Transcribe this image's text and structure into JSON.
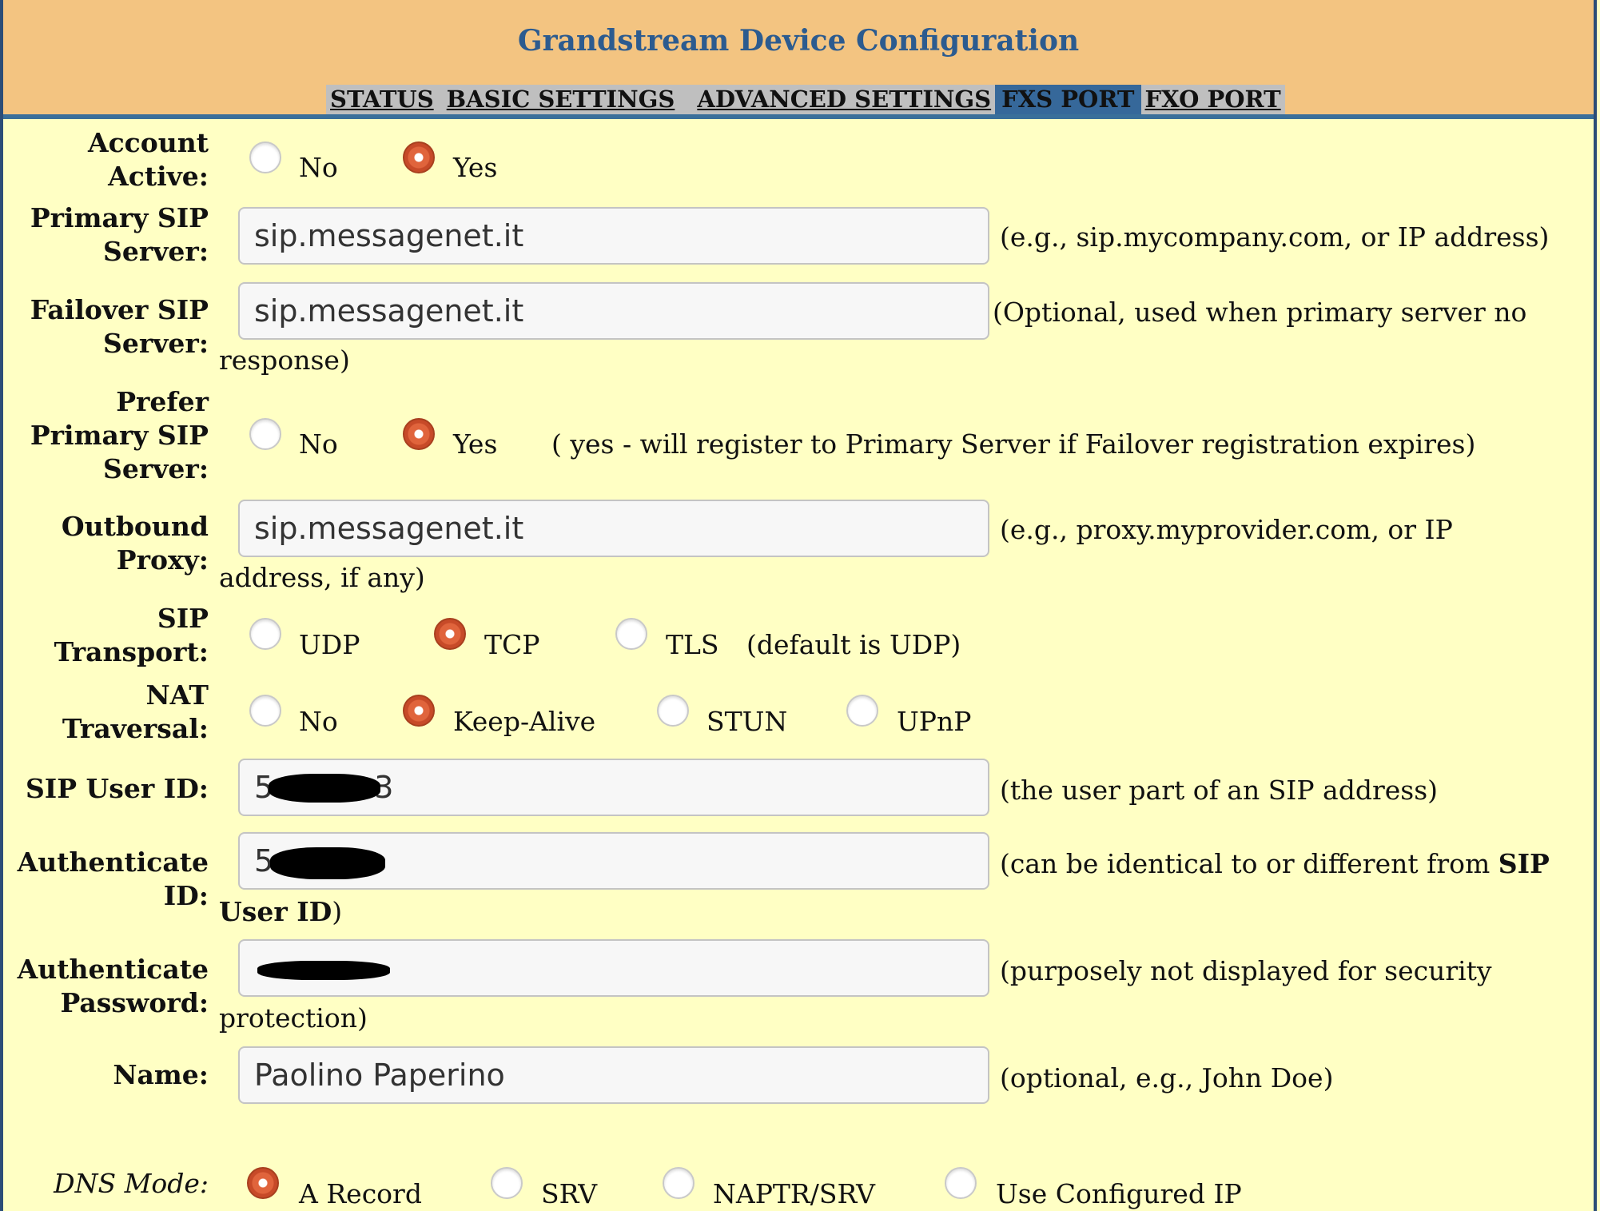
{
  "header": {
    "title": "Grandstream Device Configuration",
    "tabs": [
      "STATUS",
      "BASIC SETTINGS",
      "ADVANCED SETTINGS",
      "FXS PORT",
      "FXO PORT"
    ],
    "active_tab": "FXS PORT"
  },
  "form": {
    "account_active": {
      "label_l1": "Account",
      "label_l2": "Active:",
      "opt_no": "No",
      "opt_yes": "Yes",
      "selected": "Yes"
    },
    "primary_sip": {
      "label_l1": "Primary SIP",
      "label_l2": "Server:",
      "value": "sip.messagenet.it",
      "hint": "(e.g., sip.mycompany.com, or IP address)"
    },
    "failover_sip": {
      "label_l1": "Failover SIP",
      "label_l2": "Server:",
      "value": "sip.messagenet.it",
      "hint_l1": "(Optional, used when primary server no",
      "hint_l2": "response)"
    },
    "prefer_primary": {
      "label_l1": "Prefer",
      "label_l2": "Primary SIP",
      "label_l3": "Server:",
      "opt_no": "No",
      "opt_yes": "Yes",
      "selected": "Yes",
      "hint": "( yes - will register to Primary Server if Failover registration expires)"
    },
    "outbound_proxy": {
      "label_l1": "Outbound",
      "label_l2": "Proxy:",
      "value": "sip.messagenet.it",
      "hint_l1": "(e.g., proxy.myprovider.com, or IP",
      "hint_l2": "address, if any)"
    },
    "sip_transport": {
      "label_l1": "SIP",
      "label_l2": "Transport:",
      "opt_udp": "UDP",
      "opt_tcp": "TCP",
      "opt_tls": "TLS",
      "selected": "TCP",
      "hint": "(default is UDP)"
    },
    "nat_traversal": {
      "label_l1": "NAT",
      "label_l2": "Traversal:",
      "opt_no": "No",
      "opt_keepalive": "Keep-Alive",
      "opt_stun": "STUN",
      "opt_upnp": "UPnP",
      "selected": "Keep-Alive"
    },
    "sip_user_id": {
      "label": "SIP User ID:",
      "visible_prefix": "5",
      "visible_suffix": "3",
      "hint": "(the user part of an SIP address)"
    },
    "auth_id": {
      "label_l1": "Authenticate",
      "label_l2": "ID:",
      "visible_prefix": "5",
      "hint_l1": "(can be identical to or different from ",
      "hint_bold": "SIP",
      "hint_l2_bold": "User ID",
      "hint_l2_end": ")"
    },
    "auth_password": {
      "label_l1": "Authenticate",
      "label_l2": "Password:",
      "hint_l1": "(purposely not displayed for security",
      "hint_l2": "protection)"
    },
    "name": {
      "label": "Name:",
      "value": "Paolino Paperino",
      "hint": "(optional, e.g., John Doe)"
    },
    "dns_mode": {
      "label": "DNS Mode:",
      "opt_a": "A Record",
      "opt_srv": "SRV",
      "opt_naptr": "NAPTR/SRV",
      "opt_configured": "Use Configured IP",
      "selected": "A Record"
    }
  }
}
